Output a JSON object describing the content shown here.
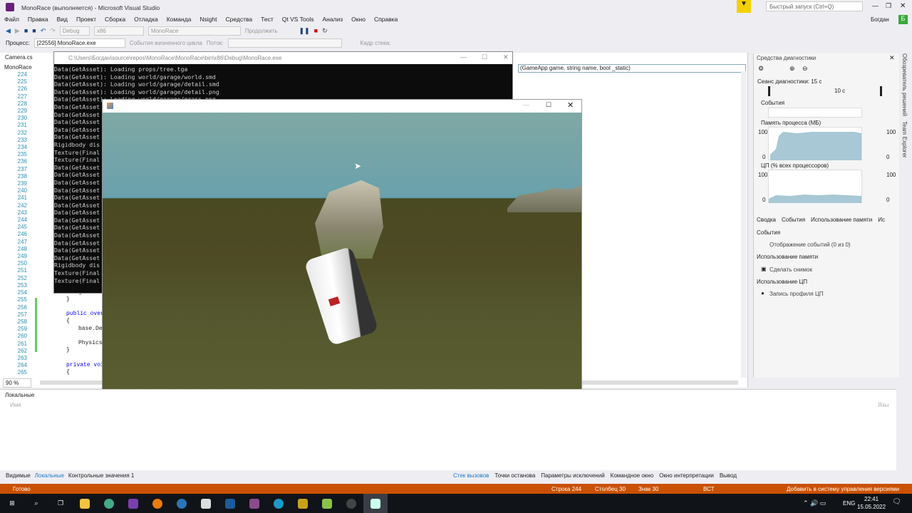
{
  "window": {
    "title": "MonoRace (выполняется) - Microsoft Visual Studio",
    "quick_launch": "Быстрый запуск (Ctrl+Q)",
    "user": "Богдан",
    "user_initial": "Б"
  },
  "menu": [
    "Файл",
    "Правка",
    "Вид",
    "Проект",
    "Сборка",
    "Отладка",
    "Команда",
    "Nsight",
    "Средства",
    "Тест",
    "Qt VS Tools",
    "Анализ",
    "Окно",
    "Справка"
  ],
  "toolbar": {
    "config": "Debug",
    "platform": "x86",
    "project": "MonoRace",
    "continue": "Продолжить"
  },
  "procbar": {
    "label": "Процесс:",
    "process": "[22556] MonoRace.exe",
    "lifecycle": "События жизненного цикла",
    "thread": "Поток:",
    "stack_frame": "Кадр стека:"
  },
  "editor": {
    "tab": "Camera.cs",
    "nav_left": "MonoRace",
    "nav_right": "(GameApp game, string name, bool _static)",
    "zoom": "90 %",
    "line_numbers": [
      "224",
      "225",
      "226",
      "227",
      "228",
      "229",
      "230",
      "231",
      "232",
      "233",
      "234",
      "235",
      "236",
      "237",
      "238",
      "239",
      "240",
      "241",
      "242",
      "243",
      "244",
      "245",
      "246",
      "247",
      "248",
      "249",
      "250",
      "251",
      "252",
      "253",
      "254",
      "255",
      "256",
      "257",
      "258",
      "259",
      "260",
      "261",
      "262",
      "263",
      "264",
      "265"
    ],
    "visible_code": [
      {
        "line": "254",
        "text": "game.Wi"
      },
      {
        "line": "255",
        "text": "}"
      },
      {
        "line": "257",
        "text": "public overr"
      },
      {
        "line": "258",
        "text": "{"
      },
      {
        "line": "259",
        "text": "base.Des"
      },
      {
        "line": "261",
        "text": "Physics."
      },
      {
        "line": "262",
        "text": "}"
      },
      {
        "line": "264",
        "text": "private void"
      },
      {
        "line": "265",
        "text": "{"
      }
    ]
  },
  "console": {
    "title": "C:\\Users\\Богдан\\source\\repos\\MonoRace\\MonoRace\\bin\\x86\\Debug\\MonoRace.exe",
    "lines": [
      "Data(GetAsset): Loading props/tree.tga",
      "Data(GetAsset): Loading world/garage/world.smd",
      "Data(GetAsset): Loading world/garage/detail.smd",
      "Data(GetAsset): Loading world/garage/detail.png",
      "Data(GetAsset): Loading world/garage/grass.png",
      "Data(GetAsset",
      "Data(GetAsset",
      "Data(GetAsset",
      "Data(GetAsset",
      "Data(GetAsset",
      "Rigidbody dis",
      "Texture(Final",
      "Texture(Final",
      "Data(GetAsset",
      "Data(GetAsset",
      "Data(GetAsset",
      "Data(GetAsset",
      "Data(GetAsset",
      "Data(GetAsset",
      "Data(GetAsset",
      "Data(GetAsset",
      "Data(GetAsset",
      "Data(GetAsset",
      "Data(GetAsset",
      "Data(GetAsset",
      "Data(GetAsset",
      "Rigidbody dis",
      "Texture(Final",
      "Texture(Final"
    ]
  },
  "diagnostics": {
    "title": "Средства диагностики",
    "session": "Сеанс диагностики: 15 с",
    "timeline_tick": "10 с",
    "events_label": "События",
    "memory_label": "Память процесса (МБ)",
    "cpu_label": "ЦП (% всех процессоров)",
    "axis_max": "100",
    "axis_min": "0",
    "graph_color": "#a7c8d4",
    "tabs": [
      "Сводка",
      "События",
      "Использование памяти",
      "Ис"
    ],
    "sections": [
      {
        "header": "События",
        "item": "Отображение событий (0 из 0)"
      },
      {
        "header": "Использование памяти",
        "item": "Сделать снимок"
      },
      {
        "header": "Использование ЦП",
        "item": "Запись профиля ЦП"
      }
    ]
  },
  "side_tabs": [
    "Обозреватель решений",
    "Team Explorer"
  ],
  "locals": {
    "title": "Локальные",
    "column": "Имя",
    "column_right": "Язы",
    "tabs": [
      "Видимые",
      "Локальные",
      "Контрольные значения 1"
    ]
  },
  "debug_tabs": [
    "Стек вызовов",
    "Точки останова",
    "Параметры исключений",
    "Командное окно",
    "Окно интерпретации",
    "Вывод"
  ],
  "status": {
    "ready": "Готово",
    "line": "Строка 244",
    "col": "Столбец 30",
    "char": "Знак 30",
    "mode": "ВСТ",
    "vcs": "Добавить в систему управления версиями",
    "color": "#ca5100"
  },
  "taskbar": {
    "time": "22:41",
    "date": "15.05.2022",
    "lang": "ENG",
    "notifications": "1"
  }
}
